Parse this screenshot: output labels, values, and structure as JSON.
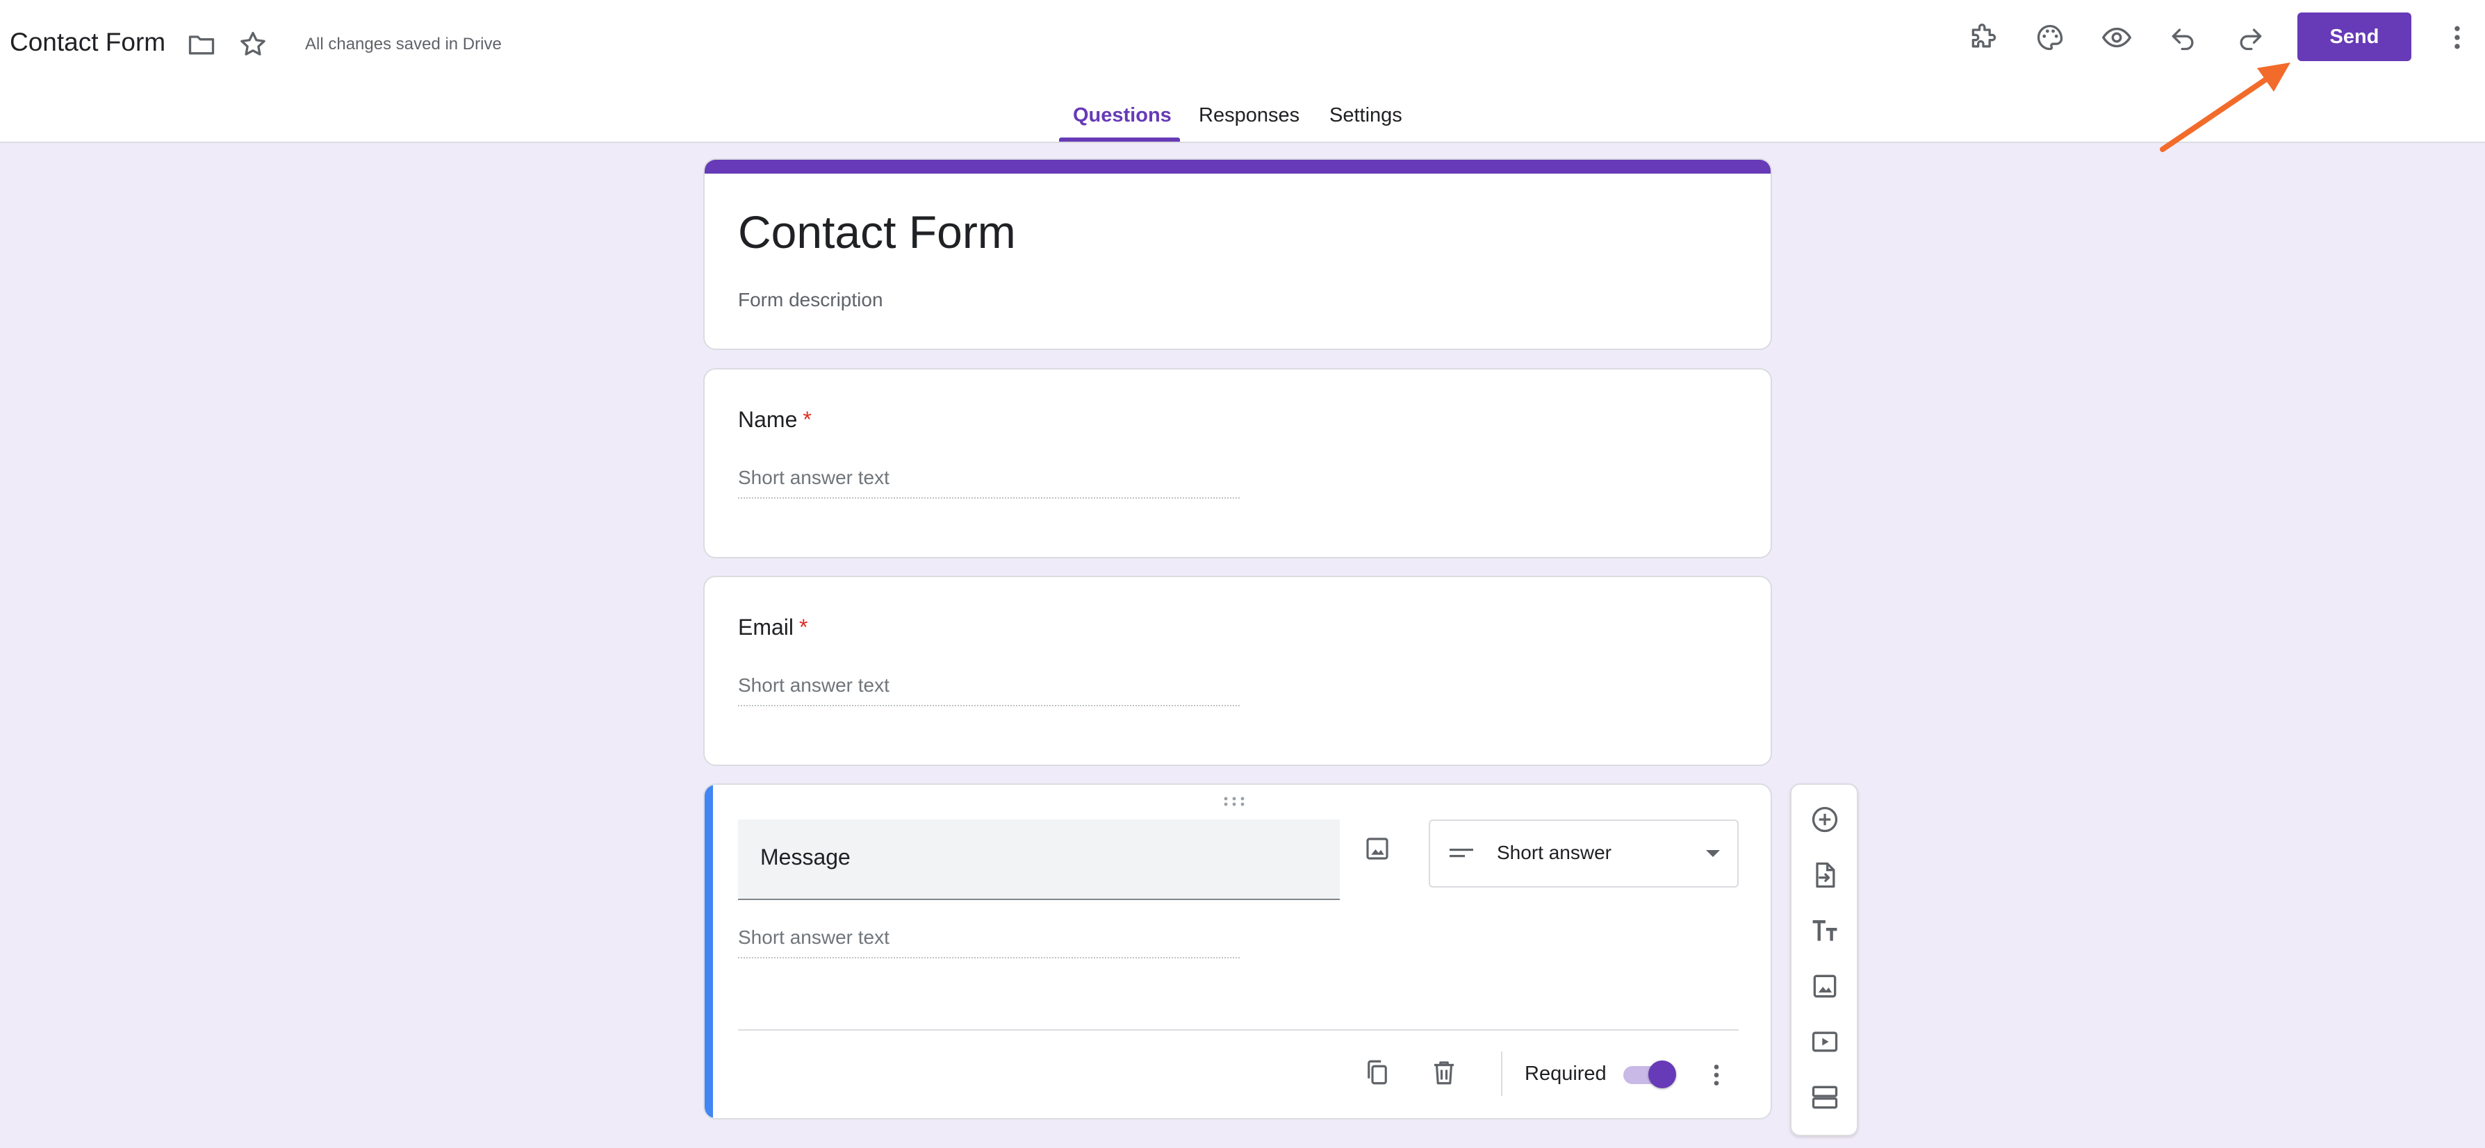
{
  "header": {
    "doc_title": "Contact Form",
    "save_status": "All changes saved in Drive",
    "send_label": "Send",
    "tabs": [
      {
        "label": "Questions",
        "active": true
      },
      {
        "label": "Responses",
        "active": false
      },
      {
        "label": "Settings",
        "active": false
      }
    ],
    "icons": [
      "folder-icon",
      "star-icon",
      "add-ons-icon",
      "palette-icon",
      "preview-icon",
      "undo-icon",
      "redo-icon",
      "more-vert-icon"
    ]
  },
  "form": {
    "title": "Contact Form",
    "description_placeholder": "Form description"
  },
  "questions": [
    {
      "title": "Name",
      "required_mark": "*",
      "answer_placeholder": "Short answer text"
    },
    {
      "title": "Email",
      "required_mark": "*",
      "answer_placeholder": "Short answer text"
    }
  ],
  "active_question": {
    "title": "Message",
    "answer_placeholder": "Short answer text",
    "type_label": "Short answer",
    "required_label": "Required",
    "required": true
  },
  "side_toolbar": [
    "add-question-icon",
    "import-questions-icon",
    "add-title-icon",
    "add-image-icon",
    "add-video-icon",
    "add-section-icon"
  ],
  "colors": {
    "accent": "#673ab7",
    "background": "#f0ebf8",
    "active_border": "#4285f4",
    "required": "#d93025",
    "annotation_arrow": "#f26b2a"
  }
}
